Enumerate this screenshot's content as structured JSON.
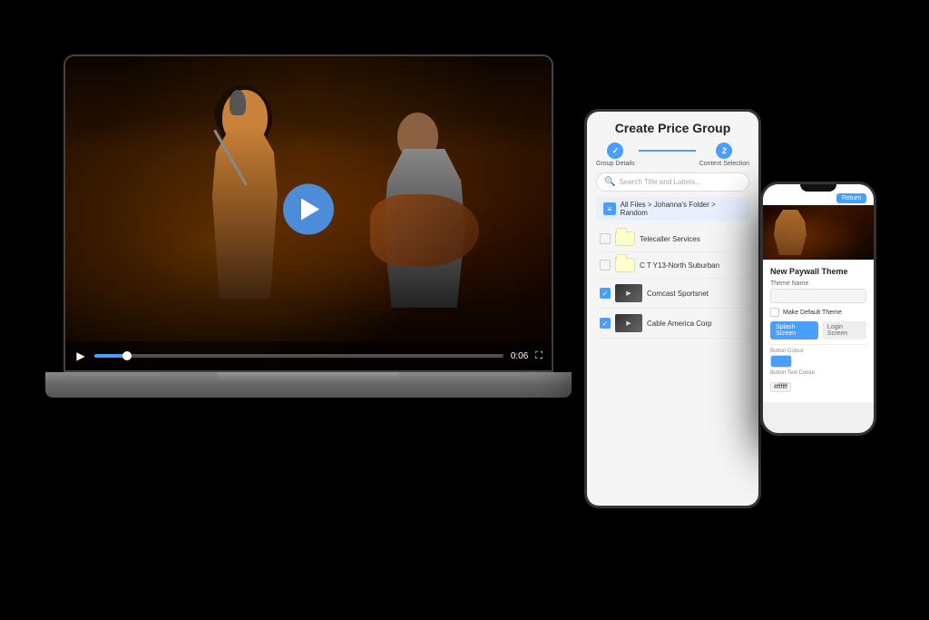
{
  "scene": {
    "background": "#000000"
  },
  "laptop": {
    "video": {
      "time_current": "0:06",
      "time_total": "0:06",
      "progress_percent": 8
    }
  },
  "tablet": {
    "title": "Create Price Group",
    "stepper": {
      "step1": {
        "label": "Group Details",
        "state": "done",
        "number": "1"
      },
      "step2": {
        "label": "Content Selection",
        "state": "active",
        "number": "2"
      }
    },
    "search": {
      "placeholder": "Search Title and Labels..."
    },
    "breadcrumb": "All Files > Johanna's Folder > Random",
    "files": [
      {
        "name": "Telecaller Services",
        "type": "folder",
        "checked": false
      },
      {
        "name": "C T Y13-North Suburban",
        "type": "folder",
        "checked": false
      },
      {
        "name": "Comcast Sportsnet",
        "type": "video",
        "checked": true
      },
      {
        "name": "Cable America Corp",
        "type": "video",
        "checked": true
      }
    ]
  },
  "phone": {
    "header_button": "Return",
    "section_title": "New Paywall Theme",
    "theme_name_label": "Theme Name",
    "theme_name_value": "",
    "default_theme_label": "Make Default Theme",
    "tab_splash": "Splash Screen",
    "tab_login": "Login Screen",
    "button_color_label": "Button Colour",
    "button_color_hex": "#4a9eff",
    "button_text_color_label": "Button Text Colour",
    "button_text_color_hex": "#ffffff"
  }
}
